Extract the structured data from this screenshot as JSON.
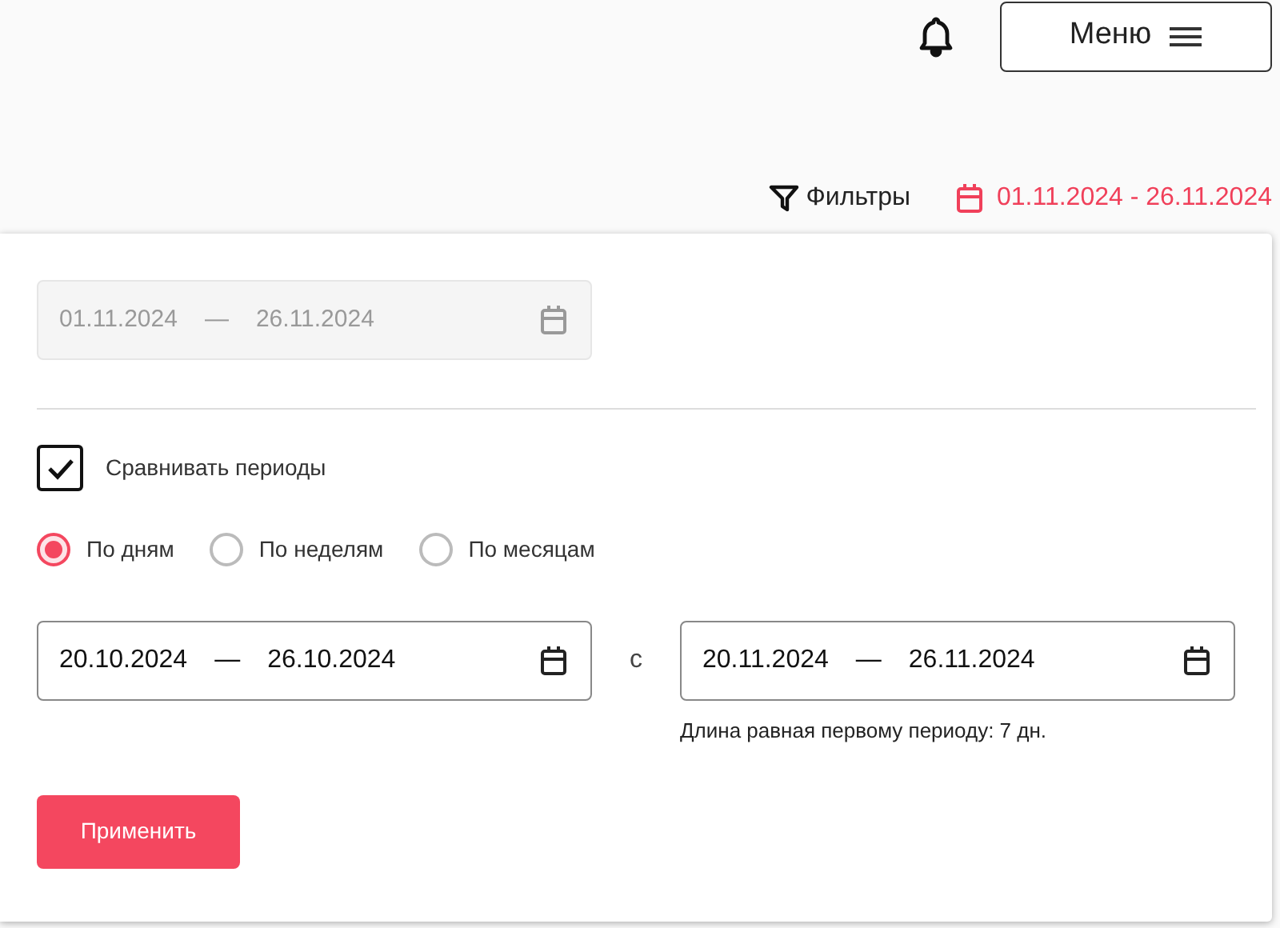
{
  "header": {
    "menu_button": "Меню"
  },
  "toolbar": {
    "filters": "Фильтры",
    "date_range": "01.11.2024 - 26.11.2024"
  },
  "main_range": {
    "from": "01.11.2024",
    "separator": "—",
    "to": "26.11.2024",
    "disabled": true
  },
  "compare": {
    "label": "Сравнивать периоды",
    "checked": true
  },
  "periods": [
    {
      "label": "По дням",
      "selected": true
    },
    {
      "label": "По неделям",
      "selected": false
    },
    {
      "label": "По месяцам",
      "selected": false
    }
  ],
  "first_range": {
    "from": "20.10.2024",
    "separator": "—",
    "to": "26.10.2024",
    "disabled": false
  },
  "connector": "с",
  "second_range": {
    "from": "20.11.2024",
    "separator": "—",
    "to": "26.11.2024",
    "disabled": false
  },
  "hint": "Длина равная первому периоду: 7 дн.",
  "apply_button": "Применить"
}
